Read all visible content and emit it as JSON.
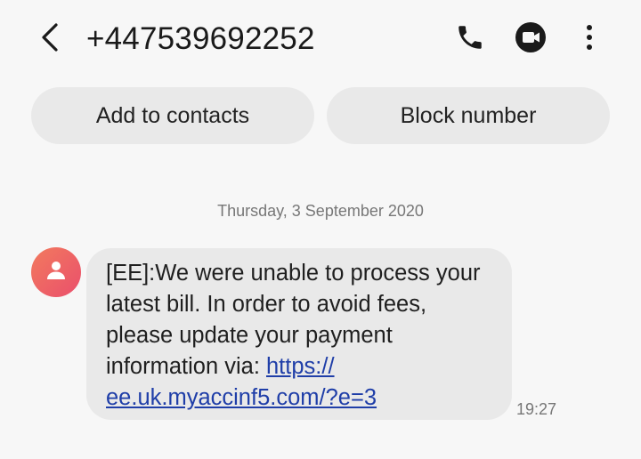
{
  "header": {
    "title": "+447539692252",
    "back_icon": "chevron-left-icon",
    "call_icon": "phone-icon",
    "video_icon": "video-camera-icon",
    "more_icon": "more-vertical-icon"
  },
  "actions": {
    "add_contact": "Add to contacts",
    "block_number": "Block number"
  },
  "conversation": {
    "date": "Thursday, 3 September 2020",
    "message": {
      "text": "[EE]:We were unable to process your latest bill. In order to avoid fees, please update your payment information via: ",
      "link": "https://​ee.uk.myaccinf5.com/?e=3",
      "time": "19:27",
      "avatar_icon": "person-icon"
    }
  },
  "colors": {
    "background": "#f7f7f7",
    "bubble": "#e9e9e9",
    "link": "#1f3ea8",
    "avatar_gradient_start": "#f27a5e",
    "avatar_gradient_end": "#ea4f6c"
  }
}
